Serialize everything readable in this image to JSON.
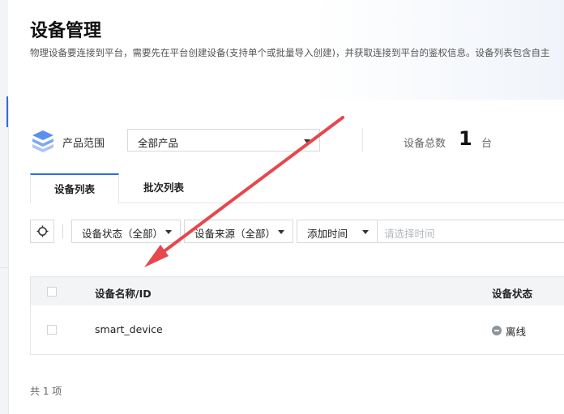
{
  "page": {
    "title": "设备管理",
    "description": "物理设备要连接到平台，需要先在平台创建设备(支持单个或批量导入创建)，并获取连接到平台的鉴权信息。设备列表包含自主"
  },
  "summary": {
    "product_scope_label": "产品范围",
    "product_scope_value": "全部产品",
    "total_label": "设备总数",
    "total_count": "1",
    "total_unit": "台",
    "icon": "cube-stack-icon"
  },
  "tabs": [
    {
      "label": "设备列表",
      "active": true
    },
    {
      "label": "批次列表",
      "active": false
    }
  ],
  "filters": {
    "refresh_icon": "gear-icon",
    "status": "设备状态（全部）",
    "source": "设备来源（全部）",
    "time": "添加时间",
    "date_placeholder": "请选择时间"
  },
  "table": {
    "columns": [
      "设备名称/ID",
      "设备状态"
    ],
    "rows": [
      {
        "name": "smart_device",
        "status": "离线"
      }
    ]
  },
  "pagination": {
    "total_text": "共 1 项"
  },
  "colors": {
    "accent": "#2a6fdb",
    "annotation_arrow": "#e5484d",
    "offline": "#8e949c"
  }
}
